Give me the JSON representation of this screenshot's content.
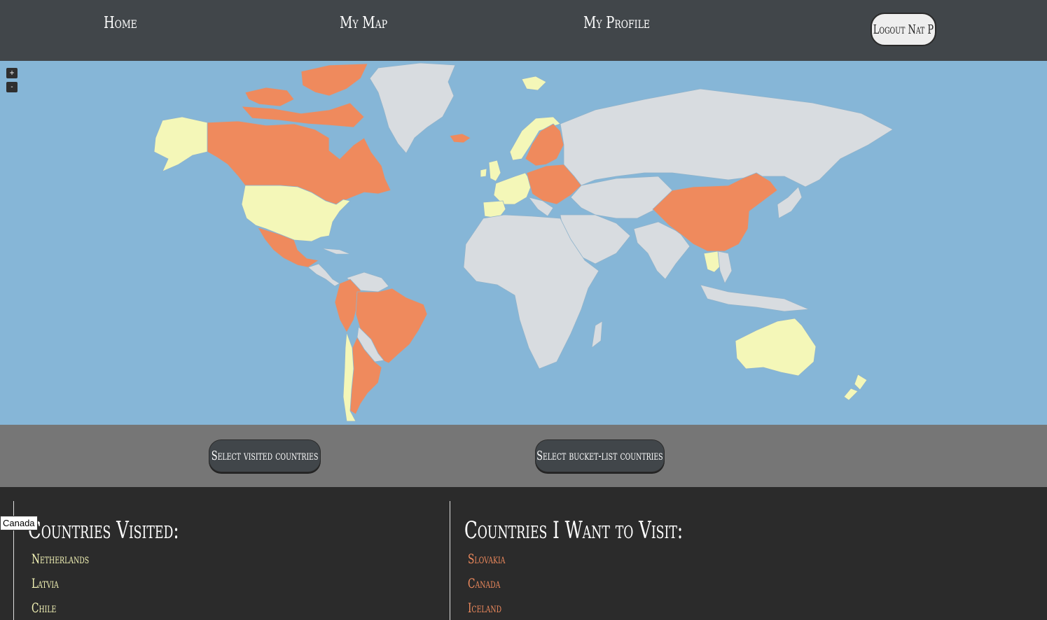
{
  "nav": {
    "home": "Home",
    "my_map": "My Map",
    "my_profile": "My Profile",
    "logout": "Logout Nat P"
  },
  "map": {
    "zoom_in": "+",
    "zoom_out": "-",
    "colors": {
      "ocean": "#86b6d7",
      "land": "#d8dce0",
      "visited": "#f4f7b8",
      "bucket": "#ef8a5d",
      "border": "#8fb3cc"
    },
    "tooltip": "Canada"
  },
  "controls": {
    "select_visited": "Select visited countries",
    "select_bucket": "Select bucket-list countries"
  },
  "visited": {
    "title": "Countries Visited:",
    "items": [
      "Netherlands",
      "Latvia",
      "Chile"
    ]
  },
  "bucket": {
    "title": "Countries I Want to Visit:",
    "items": [
      "Slovakia",
      "Canada",
      "Iceland"
    ]
  }
}
